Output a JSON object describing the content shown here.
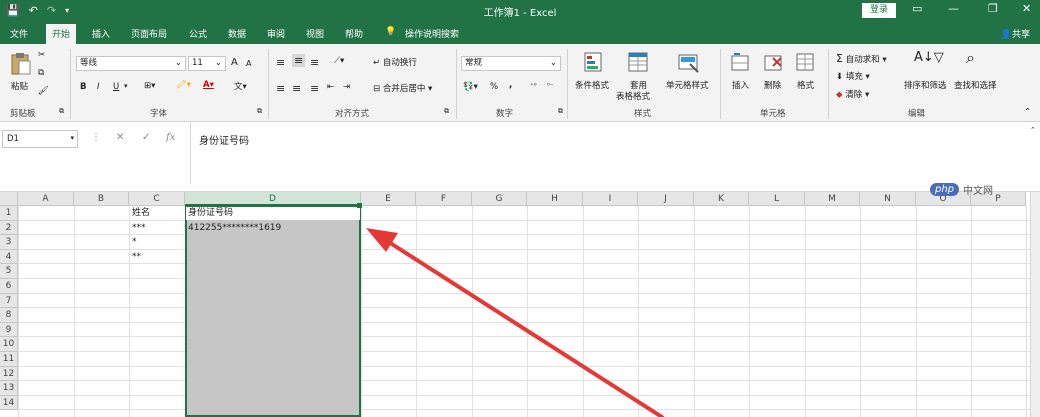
{
  "window": {
    "title": "工作簿1 - Excel",
    "login_label": "登录",
    "share_label": "共享"
  },
  "tabs": [
    "文件",
    "开始",
    "插入",
    "页面布局",
    "公式",
    "数据",
    "审阅",
    "视图",
    "帮助",
    "操作说明搜索"
  ],
  "active_tab": "开始",
  "ribbon": {
    "clipboard": {
      "paste_label": "粘贴",
      "group_label": "剪贴板"
    },
    "font": {
      "font_name": "等线",
      "font_size": "11",
      "group_label": "字体",
      "bold": "B",
      "italic": "I",
      "underline": "U",
      "grow": "A",
      "shrink": "A"
    },
    "alignment": {
      "wrap_label": "自动换行",
      "merge_label": "合并后居中",
      "group_label": "对齐方式"
    },
    "number": {
      "format": "常规",
      "percent": "%",
      "comma": ",",
      "group_label": "数字"
    },
    "styles": {
      "conditional_label": "条件格式",
      "table_label_1": "套用",
      "table_label_2": "表格格式",
      "cell_styles_label": "单元格样式",
      "group_label": "样式"
    },
    "cells": {
      "insert_label": "插入",
      "delete_label": "删除",
      "format_label": "格式",
      "group_label": "单元格"
    },
    "editing": {
      "autosum_label": "自动求和",
      "fill_label": "填充",
      "clear_label": "清除",
      "sort_label": "排序和筛选",
      "find_label": "查找和选择",
      "group_label": "编辑"
    }
  },
  "formula_bar": {
    "name_box": "D1",
    "cancel": "✕",
    "enter": "✓",
    "fx": "fx",
    "content": "身份证号码"
  },
  "columns": [
    "A",
    "B",
    "C",
    "D",
    "E",
    "F",
    "G",
    "H",
    "I",
    "J",
    "K",
    "L",
    "M",
    "N",
    "O",
    "P"
  ],
  "rows": [
    "1",
    "2",
    "3",
    "4",
    "5",
    "6",
    "7",
    "8",
    "9",
    "10",
    "11",
    "12",
    "13",
    "14"
  ],
  "cells": {
    "C1": "姓名",
    "C2": "***",
    "C3": "*",
    "C4": "**",
    "D1": "身份证号码",
    "D2": "412255********1619"
  },
  "selected_column": "D",
  "watermark": {
    "badge": "php",
    "text": "中文网"
  },
  "colors": {
    "accent": "#217346",
    "selection_fill": "#c6c6c6",
    "arrow": "#e53935"
  }
}
